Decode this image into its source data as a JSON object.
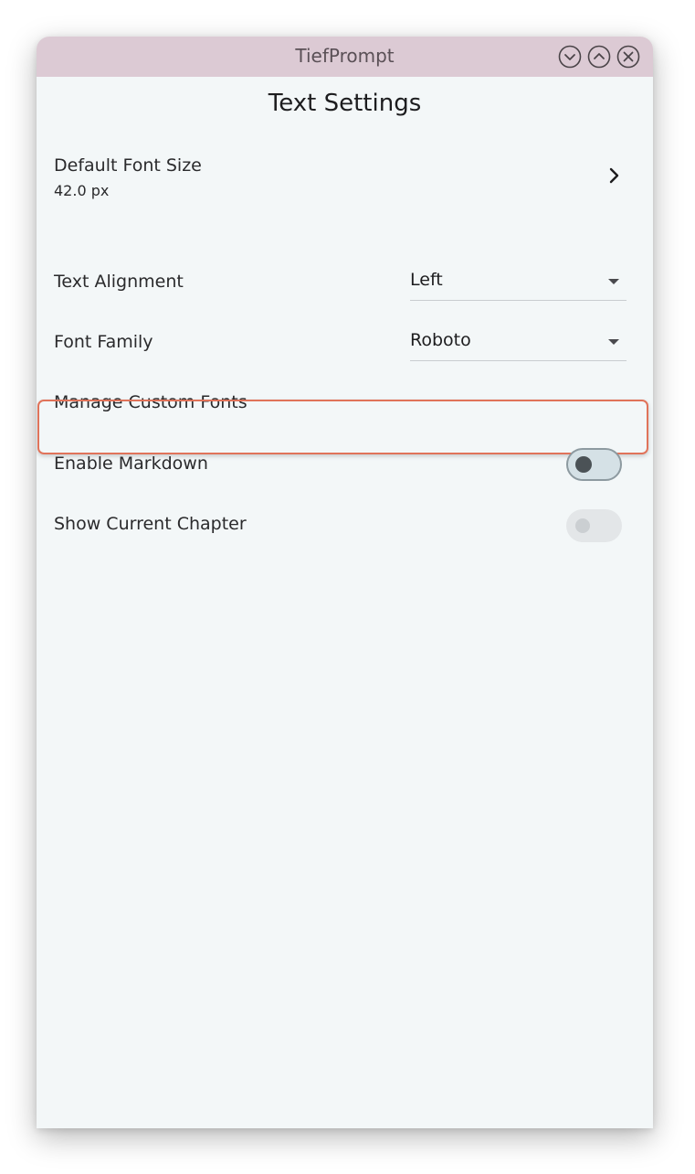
{
  "window": {
    "title": "TiefPrompt"
  },
  "page": {
    "title": "Text Settings"
  },
  "settings": {
    "font_size": {
      "label": "Default Font Size",
      "value": "42.0 px"
    },
    "text_alignment": {
      "label": "Text Alignment",
      "value": "Left"
    },
    "font_family": {
      "label": "Font Family",
      "value": "Roboto"
    },
    "custom_fonts": {
      "label": "Manage Custom Fonts"
    },
    "markdown": {
      "label": "Enable Markdown",
      "enabled": false
    },
    "current_chapter": {
      "label": "Show Current Chapter",
      "enabled": false,
      "disabled": true
    }
  },
  "icons": {
    "minimize": "chevron-down-circle-icon",
    "maximize": "chevron-up-circle-icon",
    "close": "close-circle-icon",
    "font_size_nav": "chevron-right-icon"
  },
  "colors": {
    "titlebar": "#dccad4",
    "background": "#f3f7f8",
    "highlight": "#e0735a"
  }
}
